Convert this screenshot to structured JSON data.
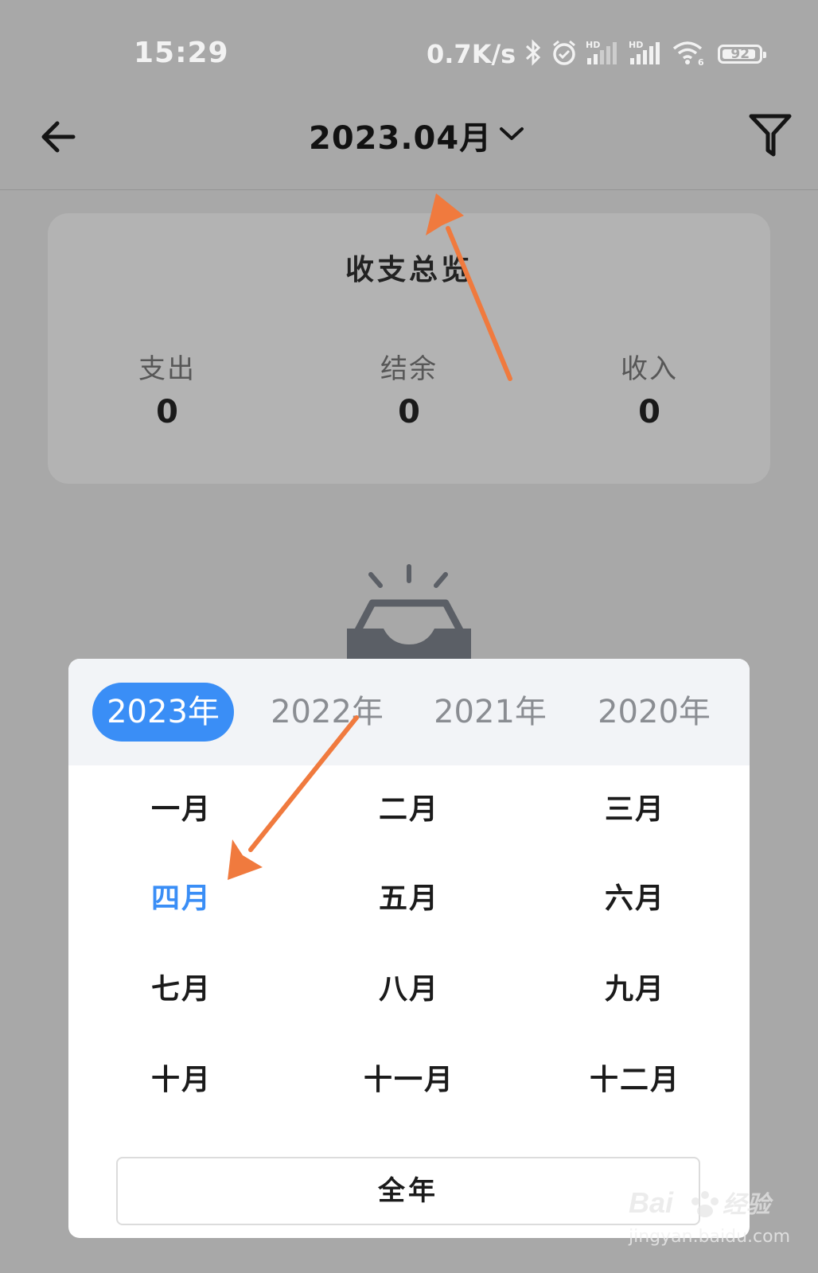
{
  "status_bar": {
    "time": "15:29",
    "net_speed": "0.7K/s",
    "battery_level": "92",
    "battery_fraction": 0.92,
    "icons": [
      "bluetooth-icon",
      "alarm-icon",
      "hd-signal-icon",
      "hd-signal-icon",
      "wifi-icon",
      "battery-icon"
    ]
  },
  "header": {
    "title": "2023.04月",
    "back_icon": "arrow-left-icon",
    "dropdown_icon": "chevron-down-icon",
    "filter_icon": "filter-icon"
  },
  "summary": {
    "title": "收支总览",
    "expense_label": "支出",
    "expense_value": "0",
    "balance_label": "结余",
    "balance_value": "0",
    "income_label": "收入",
    "income_value": "0"
  },
  "picker": {
    "years": [
      "2023年",
      "2022年",
      "2021年",
      "2020年"
    ],
    "active_year": "2023年",
    "months": [
      "一月",
      "二月",
      "三月",
      "四月",
      "五月",
      "六月",
      "七月",
      "八月",
      "九月",
      "十月",
      "十一月",
      "十二月"
    ],
    "selected_month": "四月",
    "full_year_label": "全年"
  },
  "colors": {
    "accent": "#3a8ef6",
    "annotation_arrow": "#f07a3e",
    "overlay_background": "#a8a8a8"
  },
  "watermark": {
    "logo_text": "Bai du 经验",
    "url": "jingyan.baidu.com"
  }
}
